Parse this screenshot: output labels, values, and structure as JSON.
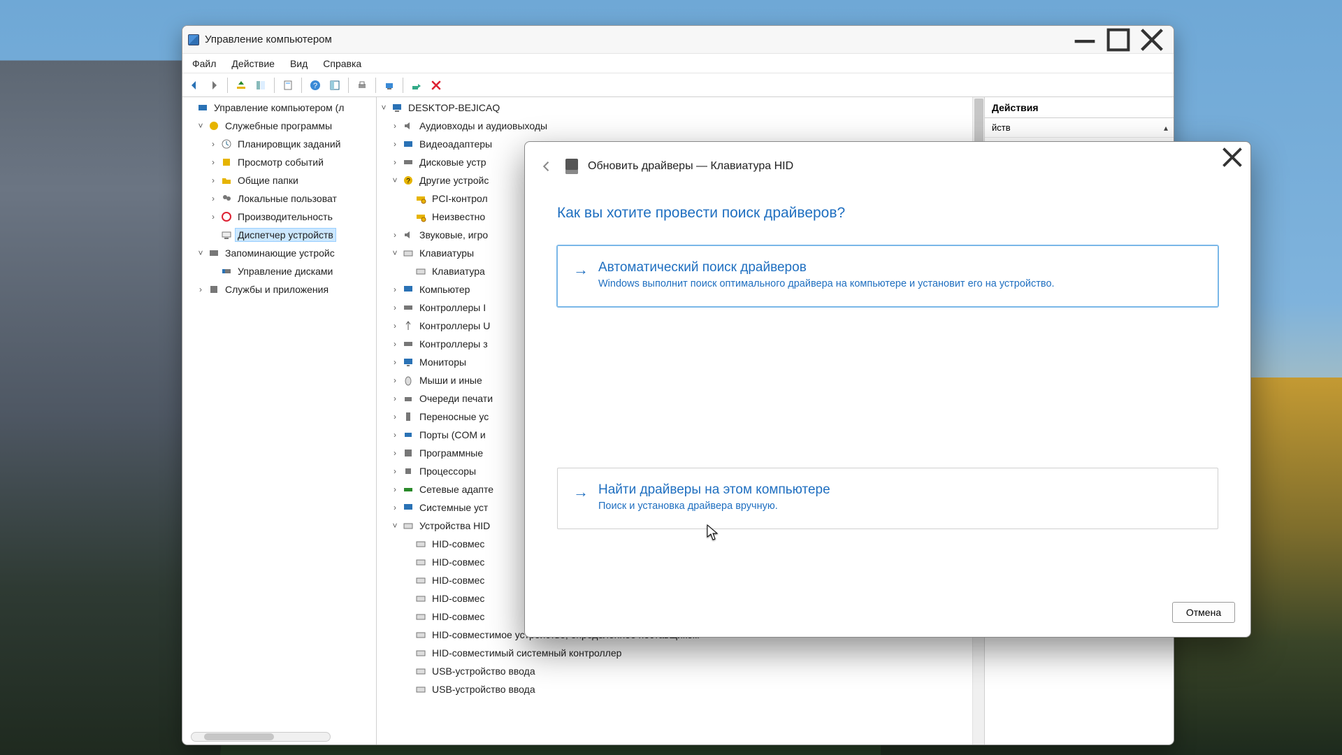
{
  "window": {
    "title": "Управление компьютером",
    "menus": [
      "Файл",
      "Действие",
      "Вид",
      "Справка"
    ]
  },
  "left_tree": {
    "root": "Управление компьютером (л",
    "n1": "Служебные программы",
    "n1a": "Планировщик заданий",
    "n1b": "Просмотр событий",
    "n1c": "Общие папки",
    "n1d": "Локальные пользоват",
    "n1e": "Производительность",
    "n1f": "Диспетчер устройств",
    "n2": "Запоминающие устройс",
    "n2a": "Управление дисками",
    "n3": "Службы и приложения"
  },
  "device_tree": {
    "root": "DESKTOP-BEJICAQ",
    "audio": "Аудиовходы и аудиовыходы",
    "video": "Видеоадаптеры",
    "disk": "Дисковые устр",
    "other": "Другие устройс",
    "other_a": "PCI-контрол",
    "other_b": "Неизвестно",
    "sound": "Звуковые, игро",
    "kbd": "Клавиатуры",
    "kbd_a": "Клавиатура",
    "computer": "Компьютер",
    "ctrl_i": "Контроллеры I",
    "ctrl_u": "Контроллеры U",
    "ctrl_z": "Контроллеры з",
    "mon": "Мониторы",
    "mouse": "Мыши и иные",
    "printq": "Очереди печати",
    "portable": "Переносные ус",
    "ports": "Порты (COM и",
    "soft": "Программные",
    "cpu": "Процессоры",
    "net": "Сетевые адапте",
    "sys": "Системные уст",
    "hid": "Устройства HID",
    "hid_a": "HID-совмес",
    "hid_b": "HID-совмес",
    "hid_c": "HID-совмес",
    "hid_d": "HID-совмес",
    "hid_e": "HID-совмес",
    "hid_f": "HID-совместимое устройство, определенное поставщиком",
    "hid_g": "HID-совместимый системный контроллер",
    "hid_h": "USB-устройство ввода",
    "hid_i": "USB-устройство ввода"
  },
  "actions": {
    "header": "Действия",
    "row1": "йств"
  },
  "dialog": {
    "title": "Обновить драйверы — Клавиатура HID",
    "question": "Как вы хотите провести поиск драйверов?",
    "opt1_title": "Автоматический поиск драйверов",
    "opt1_desc": "Windows выполнит поиск оптимального драйвера на компьютере и установит его на устройство.",
    "opt2_title": "Найти драйверы на этом компьютере",
    "opt2_desc": "Поиск и установка драйвера вручную.",
    "cancel": "Отмена"
  }
}
